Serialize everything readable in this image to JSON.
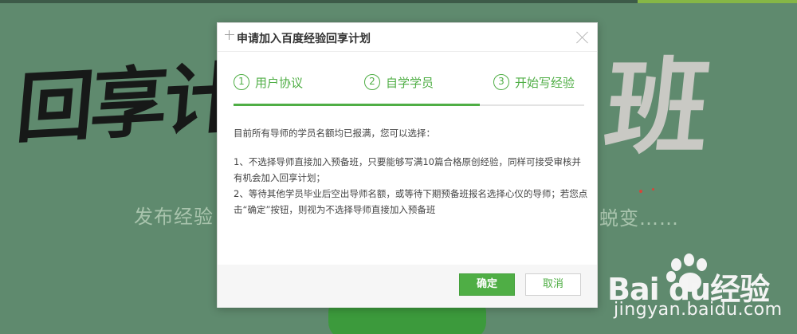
{
  "background": {
    "banner_left_text": "回享计",
    "banner_right_text": "班",
    "subtitle_left": "发布经验",
    "subtitle_right": "蜕变……",
    "button_label": "",
    "watermark_brand": "Bai du经验",
    "watermark_url": "jingyan.baidu.com"
  },
  "dialog": {
    "title": "申请加入百度经验回享计划",
    "steps": [
      {
        "number": "1",
        "label": "用户协议"
      },
      {
        "number": "2",
        "label": "自学学员"
      },
      {
        "number": "3",
        "label": "开始写经验"
      }
    ],
    "current_step": 2,
    "body": {
      "intro": "目前所有导师的学员名额均已报满，您可以选择：",
      "option1": "1、不选择导师直接加入预备班，只要能够写满10篇合格原创经验，同样可接受审核并有机会加入回享计划；",
      "option2": "2、等待其他学员毕业后空出导师名额，或等待下期预备班报名选择心仪的导师；若您点击“确定”按钮，则视为不选择导师直接加入预备班"
    },
    "buttons": {
      "ok": "确定",
      "cancel": "取消"
    }
  },
  "colors": {
    "accent": "#4fae45",
    "background": "#5f8a6e"
  }
}
